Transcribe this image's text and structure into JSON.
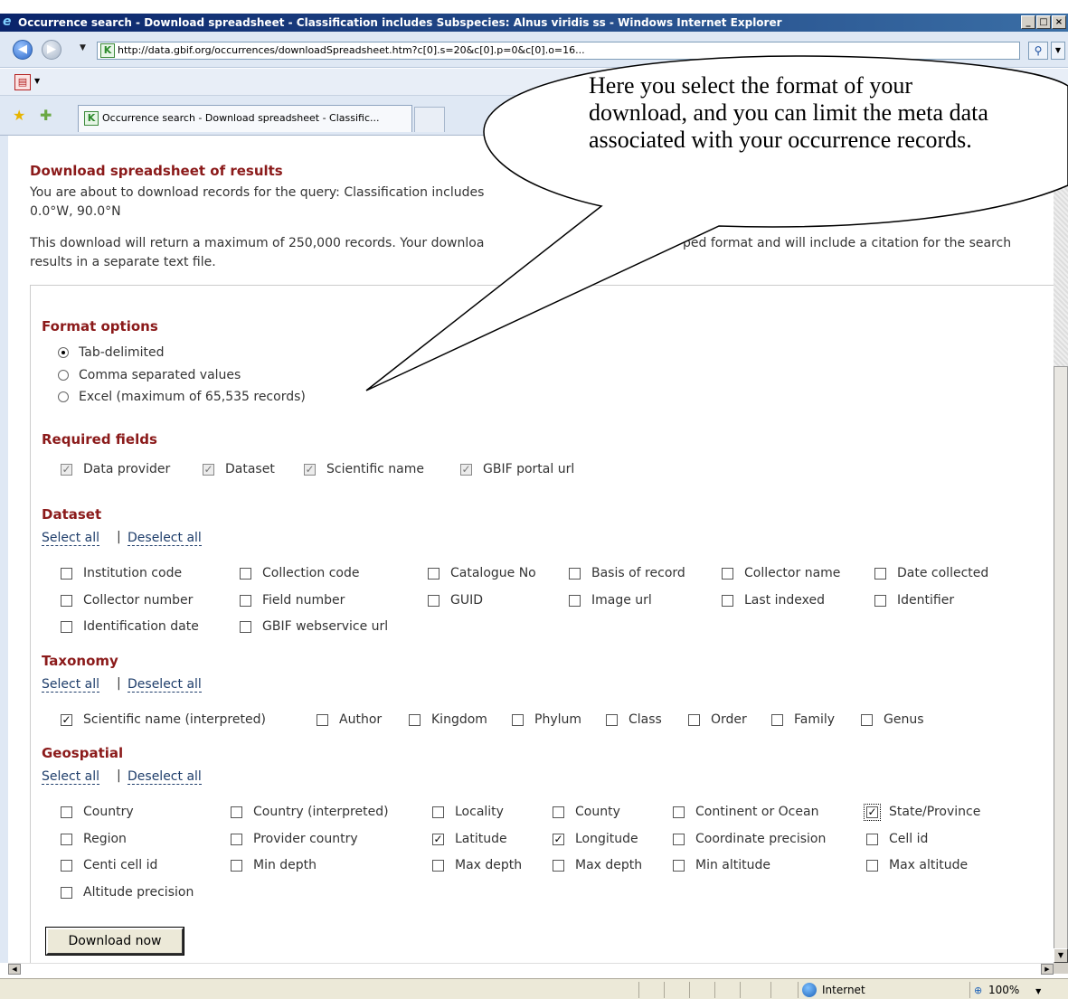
{
  "window": {
    "title": "Occurrence search - Download spreadsheet - Classification includes Subspecies: Alnus viridis ss - Windows Internet Explorer",
    "min": "_",
    "max": "□",
    "close": "×"
  },
  "address": {
    "url": "http://data.gbif.org/occurrences/downloadSpreadsheet.htm?c[0].s=20&c[0].p=0&c[0].o=16..."
  },
  "tabs": [
    {
      "label": "Occurrence search - Download spreadsheet - Classific..."
    }
  ],
  "page": {
    "heading": "Download spreadsheet of results",
    "query_line1": "You are about to download records for the query: Classification includes",
    "query_line2": "0.0°W, 90.0°N",
    "info_line1": "This download will return a maximum of 250,000 records. Your downloa",
    "info_line1b": "ped format and will include a citation for the search",
    "info_line2": "results in a separate text file."
  },
  "format": {
    "heading": "Format options",
    "options": [
      {
        "label": "Tab-delimited",
        "selected": true
      },
      {
        "label": "Comma separated values",
        "selected": false
      },
      {
        "label": "Excel (maximum of 65,535 records)",
        "selected": false
      }
    ]
  },
  "required": {
    "heading": "Required fields",
    "fields": [
      "Data provider",
      "Dataset",
      "Scientific name",
      "GBIF portal url"
    ]
  },
  "dataset": {
    "heading": "Dataset",
    "select_all": "Select all",
    "separator": "|",
    "deselect_all": "Deselect all",
    "fields": [
      {
        "label": "Institution code",
        "checked": false
      },
      {
        "label": "Collection code",
        "checked": false
      },
      {
        "label": "Catalogue No",
        "checked": false
      },
      {
        "label": "Basis of record",
        "checked": false
      },
      {
        "label": "Collector name",
        "checked": false
      },
      {
        "label": "Date collected",
        "checked": false
      },
      {
        "label": "Collector number",
        "checked": false
      },
      {
        "label": "Field number",
        "checked": false
      },
      {
        "label": "GUID",
        "checked": false
      },
      {
        "label": "Image url",
        "checked": false
      },
      {
        "label": "Last indexed",
        "checked": false
      },
      {
        "label": "Identifier",
        "checked": false
      },
      {
        "label": "Identification date",
        "checked": false
      },
      {
        "label": "GBIF webservice url",
        "checked": false
      }
    ]
  },
  "taxonomy": {
    "heading": "Taxonomy",
    "select_all": "Select all",
    "separator": "|",
    "deselect_all": "Deselect all",
    "fields": [
      {
        "label": "Scientific name (interpreted)",
        "checked": true
      },
      {
        "label": "Author",
        "checked": false
      },
      {
        "label": "Kingdom",
        "checked": false
      },
      {
        "label": "Phylum",
        "checked": false
      },
      {
        "label": "Class",
        "checked": false
      },
      {
        "label": "Order",
        "checked": false
      },
      {
        "label": "Family",
        "checked": false
      },
      {
        "label": "Genus",
        "checked": false
      }
    ]
  },
  "geospatial": {
    "heading": "Geospatial",
    "select_all": "Select all",
    "separator": "|",
    "deselect_all": "Deselect all",
    "fields": [
      {
        "label": "Country",
        "checked": false
      },
      {
        "label": "Country (interpreted)",
        "checked": false
      },
      {
        "label": "Locality",
        "checked": false
      },
      {
        "label": "County",
        "checked": false
      },
      {
        "label": "Continent or Ocean",
        "checked": false
      },
      {
        "label": "State/Province",
        "checked": true
      },
      {
        "label": "Region",
        "checked": false
      },
      {
        "label": "Provider country",
        "checked": false
      },
      {
        "label": "Latitude",
        "checked": true
      },
      {
        "label": "Longitude",
        "checked": true
      },
      {
        "label": "Coordinate precision",
        "checked": false
      },
      {
        "label": "Cell id",
        "checked": false
      },
      {
        "label": "Centi cell id",
        "checked": false
      },
      {
        "label": "Min depth",
        "checked": false
      },
      {
        "label": "Max depth",
        "checked": false
      },
      {
        "label": "Max depth",
        "checked": false
      },
      {
        "label": "Min altitude",
        "checked": false
      },
      {
        "label": "Max altitude",
        "checked": false
      },
      {
        "label": "Altitude precision",
        "checked": false
      }
    ]
  },
  "download_button": "Download now",
  "callout": {
    "text": "Here you select the format of your download, and you can limit the meta data associated with your occurrence records."
  },
  "status": {
    "zone": "Internet",
    "zoom": "100%"
  }
}
